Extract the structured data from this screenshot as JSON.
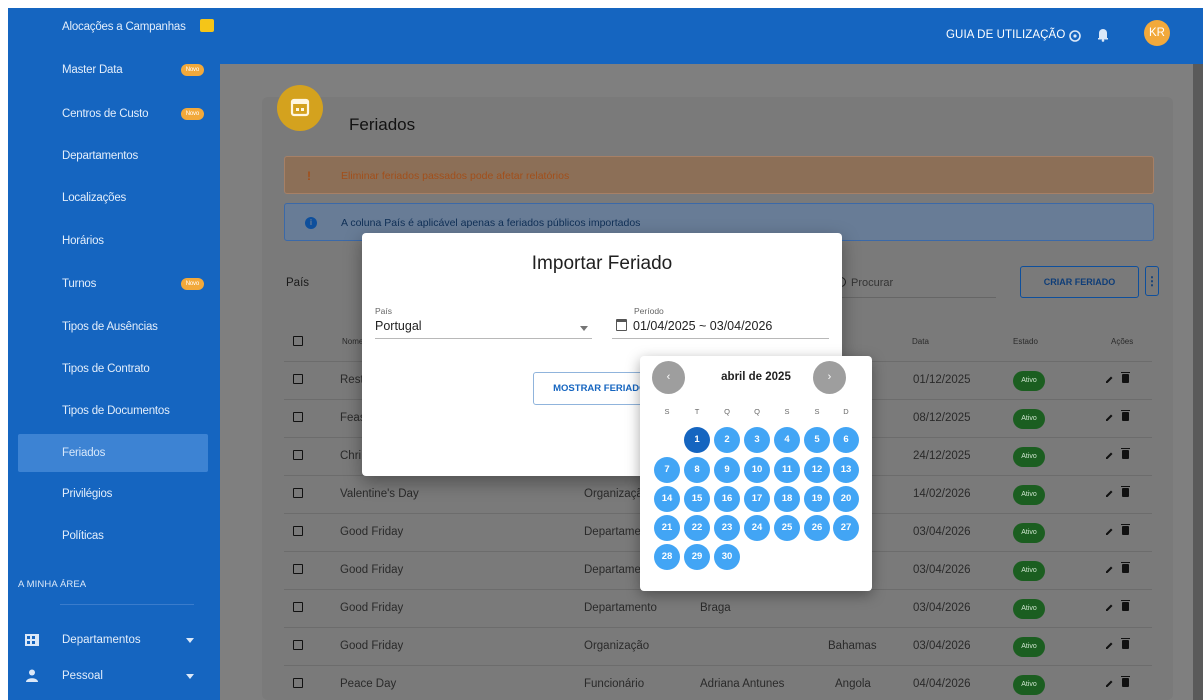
{
  "sidebar": {
    "items": [
      {
        "label": "Alocações a Campanhas",
        "badge": ""
      },
      {
        "label": "Master Data",
        "badge": "Novo"
      },
      {
        "label": "Centros de Custo",
        "badge": "Novo"
      },
      {
        "label": "Departamentos",
        "badge": ""
      },
      {
        "label": "Localizações",
        "badge": ""
      },
      {
        "label": "Horários",
        "badge": ""
      },
      {
        "label": "Turnos",
        "badge": "Novo"
      },
      {
        "label": "Tipos de Ausências",
        "badge": ""
      },
      {
        "label": "Tipos de Contrato",
        "badge": ""
      },
      {
        "label": "Tipos de Documentos",
        "badge": ""
      },
      {
        "label": "Feriados",
        "badge": ""
      },
      {
        "label": "Privilégios",
        "badge": ""
      },
      {
        "label": "Políticas",
        "badge": ""
      }
    ],
    "active_item": "Feriados",
    "section_title": "A MINHA ÁREA",
    "groups": [
      {
        "label": "Departamentos",
        "icon": "grid-icon"
      },
      {
        "label": "Pessoal",
        "icon": "person-icon"
      }
    ]
  },
  "topbar": {
    "guide_label": "GUIA DE UTILIZAÇÃO",
    "avatar_initials": "KR"
  },
  "page": {
    "title": "Feriados",
    "warning_text": "Eliminar feriados passados pode afetar relatórios",
    "warning_mark": "!",
    "info_text": "A coluna País é aplicável apenas a feriados públicos importados",
    "info_mark": "i",
    "filter_label": "País",
    "search_placeholder": "Procurar",
    "create_button": "CRIAR FERIADO",
    "more_button": "⋮"
  },
  "table": {
    "columns": {
      "name": "Nome",
      "date": "Data",
      "status": "Estado",
      "actions": "Ações"
    },
    "rows": [
      {
        "name": "Rest",
        "level": "",
        "location": "",
        "country": "",
        "date": "01/12/2025",
        "status": "Ativo"
      },
      {
        "name": "Feas",
        "level": "",
        "location": "",
        "country": "",
        "date": "08/12/2025",
        "status": "Ativo"
      },
      {
        "name": "Chri",
        "level": "",
        "location": "",
        "country": "",
        "date": "24/12/2025",
        "status": "Ativo"
      },
      {
        "name": "Valentine's Day",
        "level": "Organizaçã",
        "location": "",
        "country": "",
        "date": "14/02/2026",
        "status": "Ativo"
      },
      {
        "name": "Good Friday",
        "level": "Departame",
        "location": "",
        "country": "",
        "date": "03/04/2026",
        "status": "Ativo"
      },
      {
        "name": "Good Friday",
        "level": "Departame",
        "location": "",
        "country": "",
        "date": "03/04/2026",
        "status": "Ativo"
      },
      {
        "name": "Good Friday",
        "level": "Departamento",
        "location": "Braga",
        "country": "",
        "date": "03/04/2026",
        "status": "Ativo"
      },
      {
        "name": "Good Friday",
        "level": "Organização",
        "location": "",
        "country": "Bahamas",
        "date": "03/04/2026",
        "status": "Ativo"
      },
      {
        "name": "Peace Day",
        "level": "Funcionário",
        "location": "Adriana Antunes",
        "country": "Angola",
        "date": "04/04/2026",
        "status": "Ativo"
      }
    ]
  },
  "dialog": {
    "title": "Importar Feriado",
    "country_label": "País",
    "country_value": "Portugal",
    "period_label": "Período",
    "period_value": "01/04/2025 ~ 03/04/2026",
    "show_button": "MOSTRAR FERIADOS"
  },
  "calendar": {
    "month_label": "abril de 2025",
    "prev": "‹",
    "next": "›",
    "weekdays": [
      "S",
      "T",
      "Q",
      "Q",
      "S",
      "S",
      "D"
    ],
    "first_weekday_index": 1,
    "days_in_month": 30,
    "range_start_day": 1
  },
  "colors": {
    "primary": "#1565c0",
    "range_day": "#42a5f5",
    "status_active": "#1b5e20",
    "badge_new": "#f2a93b"
  }
}
